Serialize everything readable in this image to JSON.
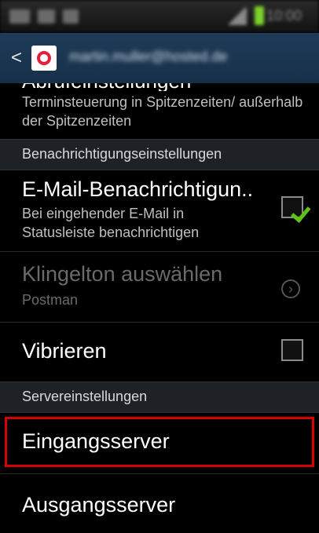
{
  "status_bar": {
    "time": "10:00"
  },
  "action_bar": {
    "back_glyph": "<",
    "app_icon": "email-app-icon",
    "account_label": "martin.muller@hosted.de"
  },
  "prefs": {
    "partial_title": "Abrufeinstellungen",
    "partial_summary": "Terminsteuerung in Spitzenzeiten/ außerhalb der Spitzenzeiten",
    "notify_section": "Benachrichtigungseinstellungen",
    "email_notify_title": "E-Mail-Benachrichtigun..",
    "email_notify_summary": "Bei eingehender E-Mail in Statusleiste benachrichtigen",
    "email_notify_checked": true,
    "ringtone_title": "Klingelton auswählen",
    "ringtone_summary": "Postman",
    "vibrate_title": "Vibrieren",
    "vibrate_checked": false,
    "server_section": "Servereinstellungen",
    "incoming_server": "Eingangsserver",
    "outgoing_server": "Ausgangsserver"
  },
  "colors": {
    "accent_check": "#5bc414",
    "highlight": "#d90000",
    "action_bar": "#1f3b57"
  }
}
